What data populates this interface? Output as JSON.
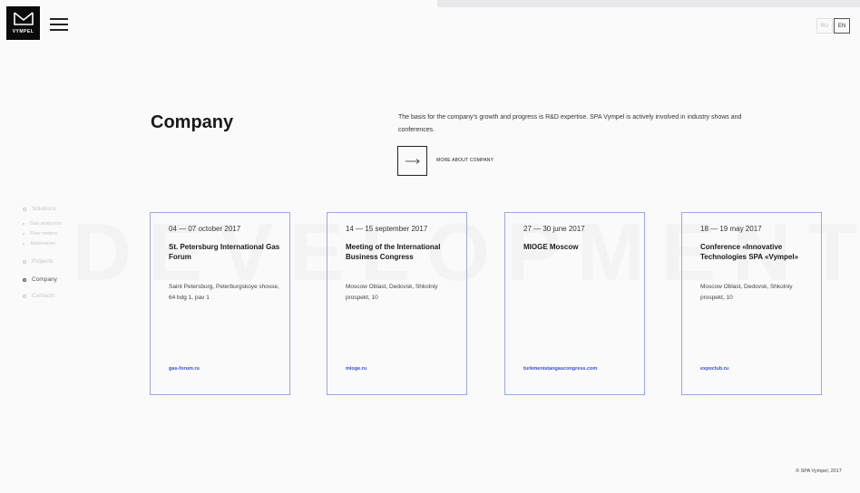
{
  "header": {
    "logo_text": "VYMPEL",
    "lang": {
      "ru": "RU",
      "en": "EN"
    }
  },
  "watermark": "DEVELOPMENT",
  "page": {
    "title": "Company",
    "intro": "The basis for the company’s growth and progress is R&D expertise. SPA Vympel is actively involved in industry shows and conferences.",
    "more_label": "MORE ABOUT COMPANY"
  },
  "sidenav": {
    "solutions": "Solutions",
    "gas_analyzers": "Gas analyzers",
    "flow_meters": "Flow meters",
    "automation": "Automation",
    "projects": "Projects",
    "company": "Company",
    "contacts": "Contacts"
  },
  "cards": [
    {
      "date": "04 — 07 october 2017",
      "title": "St. Petersburg International Gas Forum",
      "address": "Saint Petersburg, Peterburgskoye shosse, 64 bdg 1, pav 1",
      "link": "gas-forum.ru"
    },
    {
      "date": "14 — 15 september 2017",
      "title": "Meeting of the International Business Congress",
      "address": "Moscow Oblast, Dedovsk, Shkolniy prospekt, 10",
      "link": "mioge.ru"
    },
    {
      "date": "27 — 30 june 2017",
      "title": "MIOGE Moscow",
      "address": "",
      "link": "turkmenistangascongress.com"
    },
    {
      "date": "18 — 19 may 2017",
      "title": "Conference «Innovative Technologies SPA «Vympel»",
      "address": "Moscow Oblast, Dedovsk, Shkolniy prospekt, 10",
      "link": "expoclub.ru"
    }
  ],
  "footer": {
    "copyright": "© SPA Vympel, 2017"
  },
  "colors": {
    "card_border": "#9aa7e8",
    "link": "#3b4fc9"
  }
}
